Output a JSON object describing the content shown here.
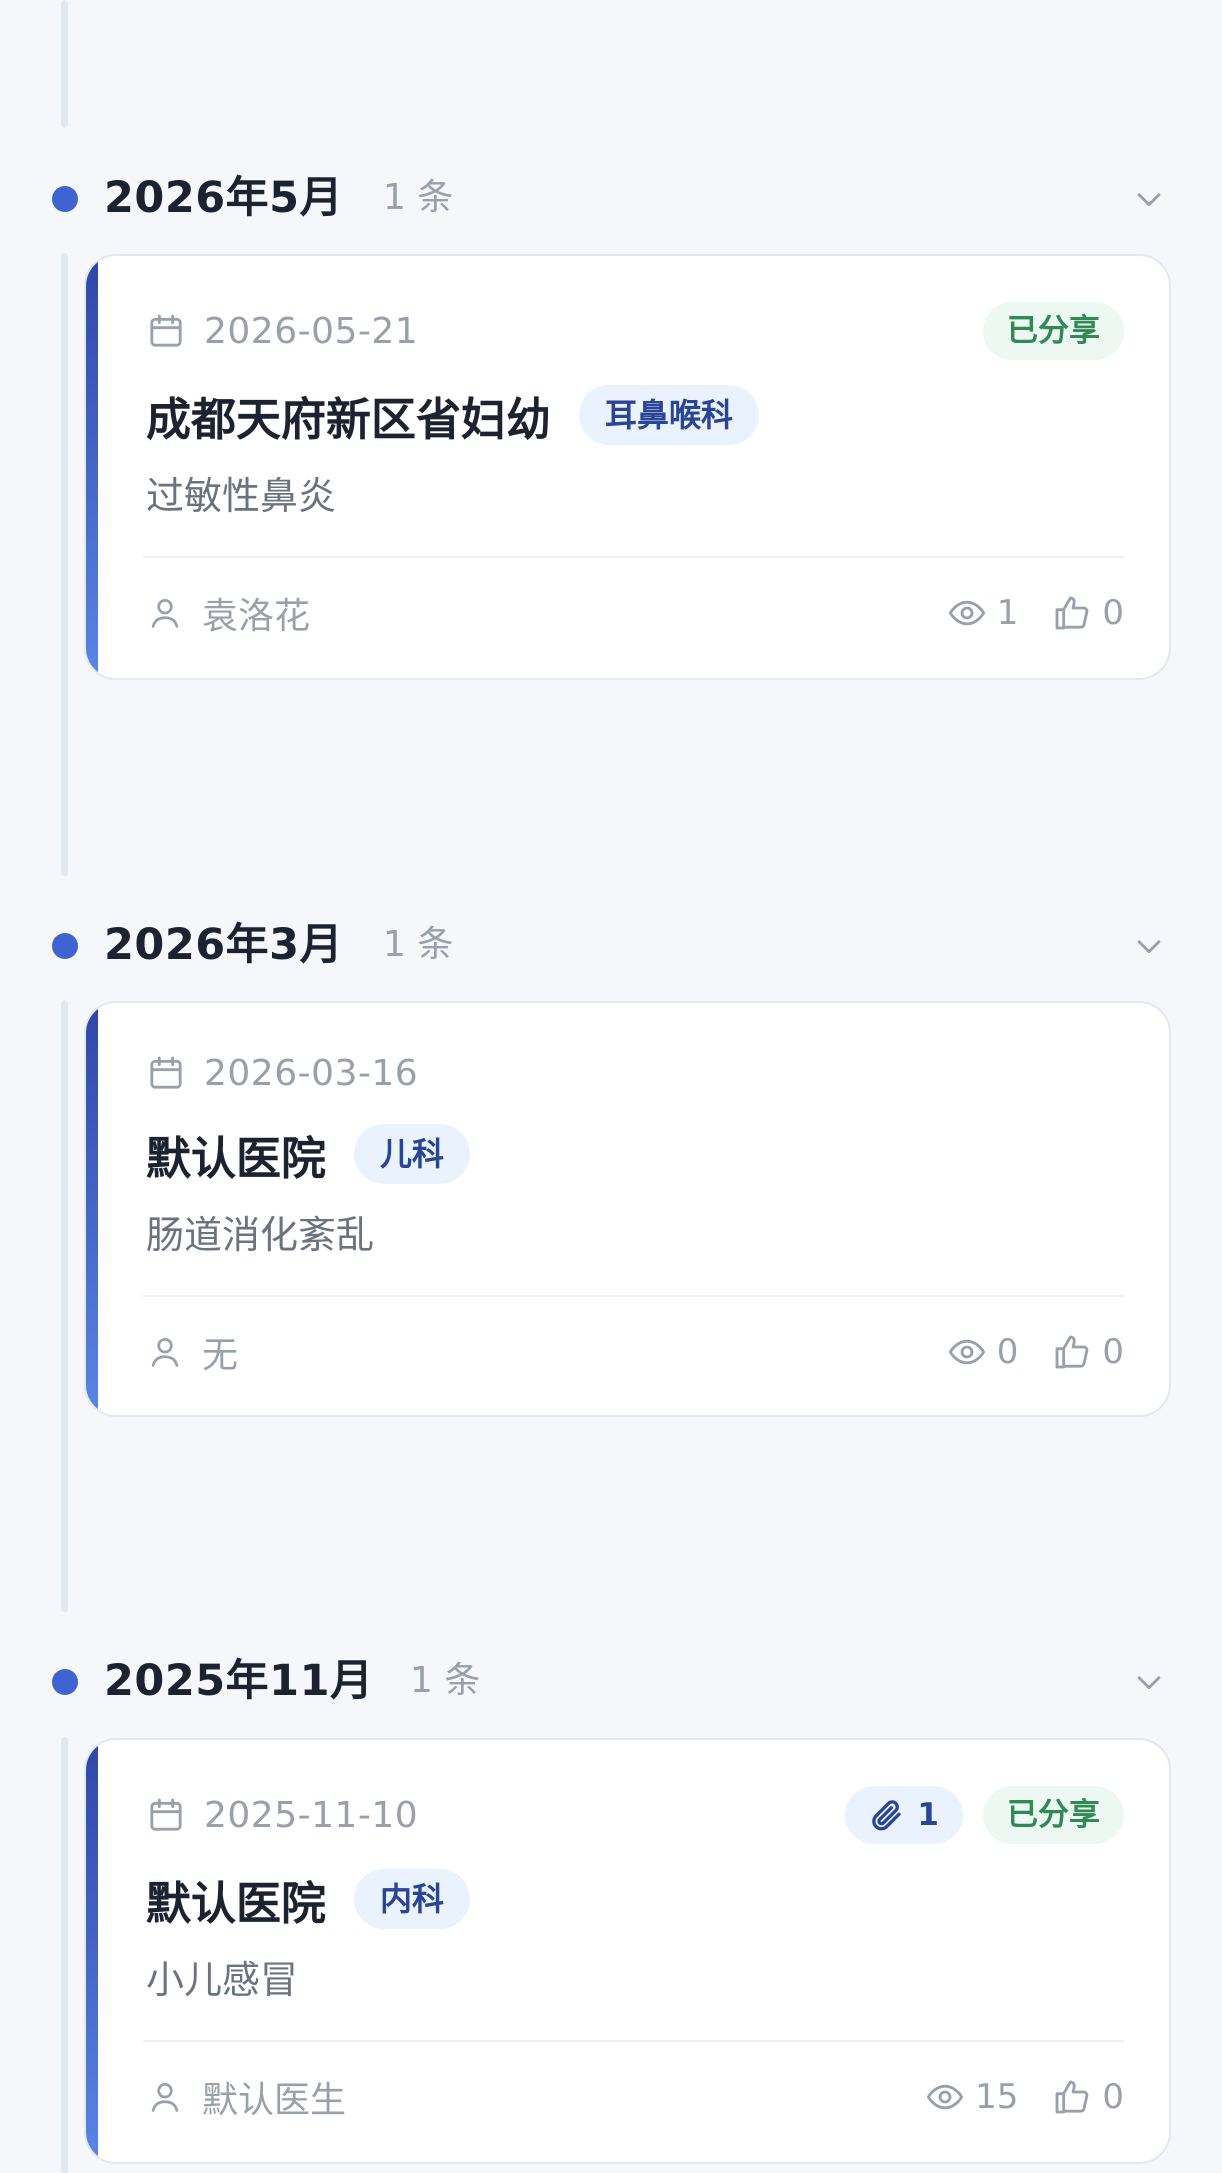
{
  "groups": [
    {
      "title": "2026年5月",
      "count": "1 条",
      "records": [
        {
          "date": "2026-05-21",
          "hospital": "成都天府新区省妇幼",
          "department": "耳鼻喉科",
          "diagnosis": "过敏性鼻炎",
          "doctor": "袁洛花",
          "views": "1",
          "likes": "0",
          "shared_label": "已分享",
          "attachments": null
        }
      ]
    },
    {
      "title": "2026年3月",
      "count": "1 条",
      "records": [
        {
          "date": "2026-03-16",
          "hospital": "默认医院",
          "department": "儿科",
          "diagnosis": "肠道消化紊乱",
          "doctor": "无",
          "views": "0",
          "likes": "0",
          "shared_label": null,
          "attachments": null
        }
      ]
    },
    {
      "title": "2025年11月",
      "count": "1 条",
      "records": [
        {
          "date": "2025-11-10",
          "hospital": "默认医院",
          "department": "内科",
          "diagnosis": "小儿感冒",
          "doctor": "默认医生",
          "views": "15",
          "likes": "0",
          "shared_label": "已分享",
          "attachments": "1"
        }
      ]
    }
  ],
  "icons": {
    "date": "calendar-icon",
    "doctor": "user-icon",
    "views": "eye-icon",
    "likes": "thumbs-up-icon",
    "attachment": "paperclip-icon",
    "collapse": "chevron-down-icon"
  },
  "colors": {
    "accent": "#3f63d1",
    "shared_bg": "#ecf8f1",
    "shared_text": "#2f8a55",
    "tag_bg": "#eaf2fd",
    "tag_text": "#2b4596"
  }
}
